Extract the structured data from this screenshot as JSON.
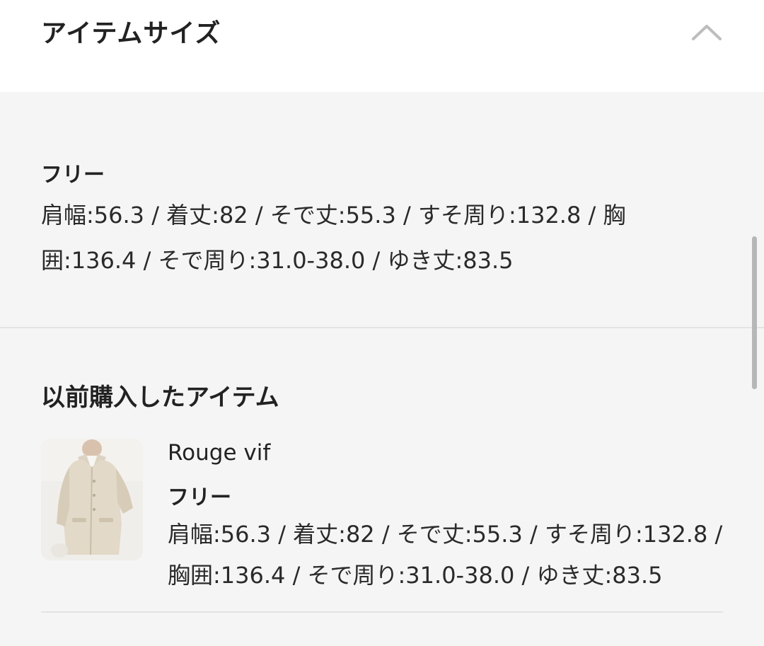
{
  "header": {
    "title": "アイテムサイズ",
    "collapse_icon": "chevron-up-icon"
  },
  "size_section": {
    "size_name": "フリー",
    "measurements": "肩幅:56.3 / 着丈:82 / そで丈:55.3 / すそ周り:132.8 / 胸囲:136.4 / そで周り:31.0-38.0 / ゆき丈:83.5"
  },
  "previous_purchases": {
    "title": "以前購入したアイテム",
    "items": [
      {
        "brand": "Rouge vif",
        "size_name": "フリー",
        "measurements": "肩幅:56.3 / 着丈:82 / そで丈:55.3 / すそ周り:132.8 / 胸囲:136.4 / そで周り:31.0-38.0 / ゆき丈:83.5",
        "thumbnail": "coat-photo"
      }
    ]
  },
  "colors": {
    "background": "#f5f5f5",
    "header_background": "#ffffff",
    "divider": "#e3e3e3",
    "chevron": "#bdbdbd",
    "scrollbar": "#b7b7b7"
  }
}
